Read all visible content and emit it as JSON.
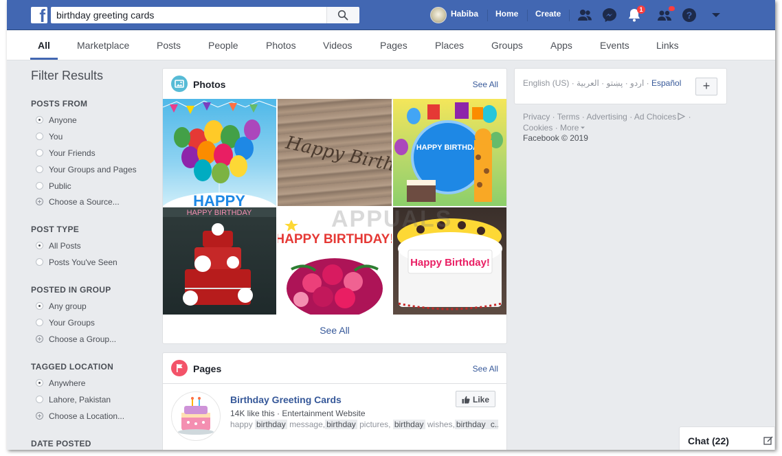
{
  "topbar": {
    "search_value": "birthday greeting cards",
    "user_name": "Habiba",
    "home_label": "Home",
    "create_label": "Create",
    "notifications_count": "1",
    "icons": [
      "facebook-logo",
      "search-icon",
      "friend-requests-icon",
      "messenger-icon",
      "notifications-icon",
      "quick-help-people-icon",
      "help-icon",
      "account-menu-caret-icon"
    ],
    "accent_color": "#4267b2"
  },
  "tabs": [
    {
      "label": "All",
      "active": true
    },
    {
      "label": "Marketplace"
    },
    {
      "label": "Posts"
    },
    {
      "label": "People"
    },
    {
      "label": "Photos"
    },
    {
      "label": "Videos"
    },
    {
      "label": "Pages"
    },
    {
      "label": "Places"
    },
    {
      "label": "Groups"
    },
    {
      "label": "Apps"
    },
    {
      "label": "Events"
    },
    {
      "label": "Links"
    }
  ],
  "filters": {
    "title": "Filter Results",
    "posts_from": {
      "heading": "POSTS FROM",
      "options": [
        {
          "label": "Anyone",
          "selected": true
        },
        {
          "label": "You"
        },
        {
          "label": "Your Friends"
        },
        {
          "label": "Your Groups and Pages"
        },
        {
          "label": "Public"
        }
      ],
      "choose": "Choose a Source..."
    },
    "post_type": {
      "heading": "POST TYPE",
      "options": [
        {
          "label": "All Posts",
          "selected": true
        },
        {
          "label": "Posts You've Seen"
        }
      ]
    },
    "posted_in_group": {
      "heading": "POSTED IN GROUP",
      "options": [
        {
          "label": "Any group",
          "selected": true
        },
        {
          "label": "Your Groups"
        }
      ],
      "choose": "Choose a Group..."
    },
    "tagged_location": {
      "heading": "TAGGED LOCATION",
      "options": [
        {
          "label": "Anywhere",
          "selected": true
        },
        {
          "label": "Lahore, Pakistan"
        }
      ],
      "choose": "Choose a Location..."
    },
    "date_posted": {
      "heading": "DATE POSTED"
    }
  },
  "photos": {
    "title": "Photos",
    "see_all": "See All",
    "see_all_bottom": "See All",
    "images": [
      {
        "name": "balloons-happy",
        "caption": "HAPPY"
      },
      {
        "name": "wood-happy-birthday",
        "caption": "Happy Birthday"
      },
      {
        "name": "giraffe-happy-birthday",
        "caption": "HAPPY BIRTHDAY"
      },
      {
        "name": "red-cake-happy-birthday",
        "caption": "HAPPY BIRTHDAY"
      },
      {
        "name": "flowers-happy-birthday",
        "caption": "HAPPY BIRTHDAY!"
      },
      {
        "name": "sunflower-cake",
        "caption": "Happy Birthday!"
      }
    ]
  },
  "pages": {
    "title": "Pages",
    "see_all": "See All",
    "item": {
      "name": "Birthday Greeting Cards",
      "meta": "14K like this · Entertainment Website",
      "snippet": [
        {
          "t": "happy "
        },
        {
          "t": "birthday",
          "hl": true
        },
        {
          "t": " message,"
        },
        {
          "t": "birthday",
          "hl": true
        },
        {
          "t": " pictures, "
        },
        {
          "t": "birthday",
          "hl": true
        },
        {
          "t": " wishes,"
        },
        {
          "t": "birthday",
          "hl": true
        },
        {
          "t": " c...",
          "hl": true
        }
      ],
      "like_label": "Like"
    }
  },
  "right": {
    "lang_current": "English (US)",
    "lang_others": [
      "اردو",
      "پښتو",
      "العربية"
    ],
    "lang_es": "Español",
    "plus": "+",
    "footer_links": [
      "Privacy",
      "Terms",
      "Advertising",
      "Ad Choices",
      "Cookies",
      "More"
    ],
    "copyright": "Facebook © 2019"
  },
  "chat": {
    "label": "Chat (22)"
  },
  "watermark": "APPUALS"
}
